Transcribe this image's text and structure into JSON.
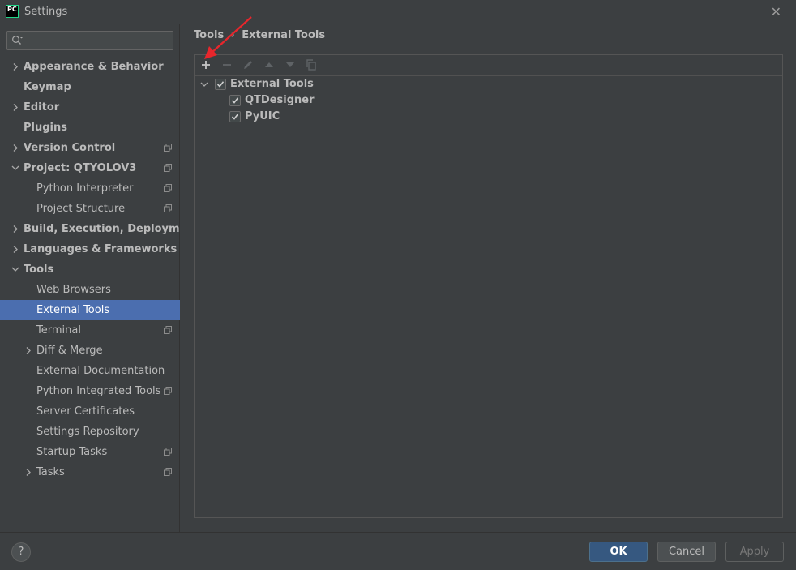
{
  "window": {
    "title": "Settings",
    "app_icon": "pycharm-icon",
    "close_glyph": "✕"
  },
  "search": {
    "value": "",
    "placeholder": ""
  },
  "sidebar": {
    "items": [
      {
        "label": "Appearance & Behavior",
        "level": 0,
        "chevron": "right",
        "project_icon": false
      },
      {
        "label": "Keymap",
        "level": 0,
        "chevron": "none",
        "project_icon": false
      },
      {
        "label": "Editor",
        "level": 0,
        "chevron": "right",
        "project_icon": false
      },
      {
        "label": "Plugins",
        "level": 0,
        "chevron": "none",
        "project_icon": false
      },
      {
        "label": "Version Control",
        "level": 0,
        "chevron": "right",
        "project_icon": true
      },
      {
        "label": "Project: QTYOLOV3",
        "level": 0,
        "chevron": "down",
        "project_icon": true
      },
      {
        "label": "Python Interpreter",
        "level": 1,
        "chevron": "none",
        "project_icon": true
      },
      {
        "label": "Project Structure",
        "level": 1,
        "chevron": "none",
        "project_icon": true
      },
      {
        "label": "Build, Execution, Deployment",
        "level": 0,
        "chevron": "right",
        "project_icon": false
      },
      {
        "label": "Languages & Frameworks",
        "level": 0,
        "chevron": "right",
        "project_icon": false
      },
      {
        "label": "Tools",
        "level": 0,
        "chevron": "down",
        "project_icon": false
      },
      {
        "label": "Web Browsers",
        "level": 1,
        "chevron": "none",
        "project_icon": false
      },
      {
        "label": "External Tools",
        "level": 1,
        "chevron": "none",
        "project_icon": false,
        "selected": true
      },
      {
        "label": "Terminal",
        "level": 1,
        "chevron": "none",
        "project_icon": true
      },
      {
        "label": "Diff & Merge",
        "level": 1,
        "chevron": "right",
        "project_icon": false
      },
      {
        "label": "External Documentation",
        "level": 1,
        "chevron": "none",
        "project_icon": false
      },
      {
        "label": "Python Integrated Tools",
        "level": 1,
        "chevron": "none",
        "project_icon": true
      },
      {
        "label": "Server Certificates",
        "level": 1,
        "chevron": "none",
        "project_icon": false
      },
      {
        "label": "Settings Repository",
        "level": 1,
        "chevron": "none",
        "project_icon": false
      },
      {
        "label": "Startup Tasks",
        "level": 1,
        "chevron": "none",
        "project_icon": true
      },
      {
        "label": "Tasks",
        "level": 1,
        "chevron": "right",
        "project_icon": true
      }
    ]
  },
  "breadcrumb": {
    "parent": "Tools",
    "separator": "›",
    "current": "External Tools"
  },
  "toolbar": {
    "buttons": [
      {
        "icon": "add-icon",
        "enabled": true
      },
      {
        "icon": "remove-icon",
        "enabled": false
      },
      {
        "icon": "edit-icon",
        "enabled": false
      },
      {
        "icon": "move-up-icon",
        "enabled": false
      },
      {
        "icon": "move-down-icon",
        "enabled": false
      },
      {
        "icon": "copy-icon",
        "enabled": false
      }
    ]
  },
  "tools_tree": {
    "group": {
      "label": "External Tools",
      "checked": true,
      "expanded": true
    },
    "items": [
      {
        "label": "QTDesigner",
        "checked": true
      },
      {
        "label": "PyUIC",
        "checked": true
      }
    ]
  },
  "footer": {
    "help": "?",
    "ok_label": "OK",
    "cancel_label": "Cancel",
    "apply_label": "Apply",
    "apply_enabled": false
  },
  "colors": {
    "background": "#3c3f41",
    "selection": "#4b6eaf",
    "primary_button": "#365880",
    "annotation_arrow": "#e8262c"
  }
}
